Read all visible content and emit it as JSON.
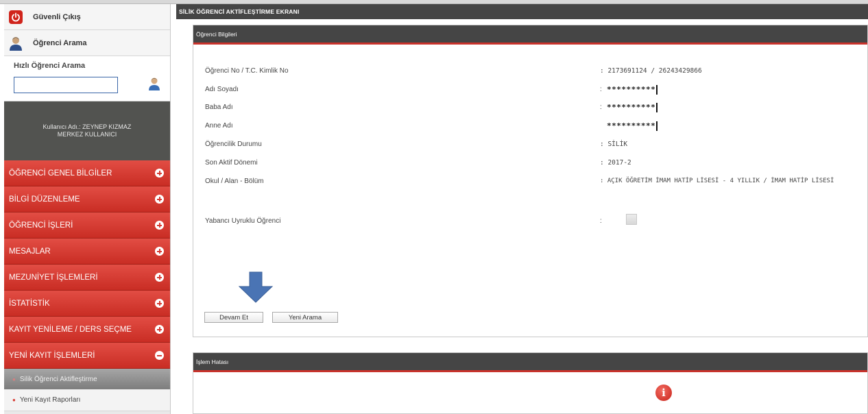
{
  "sidebar": {
    "logout_label": "Güvenli Çıkış",
    "search_link_label": "Öğrenci Arama",
    "quick_search": {
      "label": "Hızlı Öğrenci Arama",
      "value": "",
      "placeholder": ""
    },
    "user": {
      "line1": "Kullanıcı Adı.: ZEYNEP KIZMAZ",
      "line2": "MERKEZ KULLANICI"
    },
    "menu": [
      {
        "label": "ÖĞRENCİ GENEL BİLGİLER",
        "expanded": false
      },
      {
        "label": "BİLGİ DÜZENLEME",
        "expanded": false
      },
      {
        "label": "ÖĞRENCİ İŞLERİ",
        "expanded": false
      },
      {
        "label": "MESAJLAR",
        "expanded": false
      },
      {
        "label": "MEZUNİYET İŞLEMLERİ",
        "expanded": false
      },
      {
        "label": "İSTATİSTİK",
        "expanded": false
      },
      {
        "label": "KAYIT YENİLEME / DERS SEÇME",
        "expanded": false
      },
      {
        "label": "YENİ KAYIT İŞLEMLERİ",
        "expanded": true
      }
    ],
    "submenu": [
      {
        "label": "Silik Öğrenci Aktifleştirme",
        "active": true
      },
      {
        "label": "Yeni Kayıt Raporları",
        "active": false
      }
    ]
  },
  "page": {
    "title": "SİLİK ÖĞRENCİ AKTİFLEŞTİRME EKRANI",
    "info_panel": {
      "title": "Öğrenci Bilgileri",
      "fields": [
        {
          "label": "Öğrenci No / T.C. Kimlik No",
          "value": ": 2173691124 / 26243429866"
        },
        {
          "label": "Adı Soyadı",
          "value": "**********"
        },
        {
          "label": "Baba Adı",
          "value": "**********"
        },
        {
          "label": "Anne Adı",
          "value": "**********"
        },
        {
          "label": "Öğrencilik Durumu",
          "value": ": SİLİK"
        },
        {
          "label": "Son Aktif Dönemi",
          "value": ": 2017-2"
        },
        {
          "label": "Okul / Alan - Bölüm",
          "value": ": AÇIK ÖĞRETİM İMAM HATİP LİSESİ - 4 YILLIK / İMAM HATİP LİSESİ"
        }
      ],
      "foreign_label": "Yabancı Uyruklu Öğrenci",
      "foreign_checked": false,
      "colon": ":",
      "continue_button": "Devam Et",
      "new_search_button": "Yeni Arama"
    },
    "error_panel": {
      "title": "İşlem Hatası"
    }
  },
  "colors": {
    "menu_red": "#d63a32",
    "header_dark": "#454545",
    "arrow_blue": "#4a74b4"
  }
}
